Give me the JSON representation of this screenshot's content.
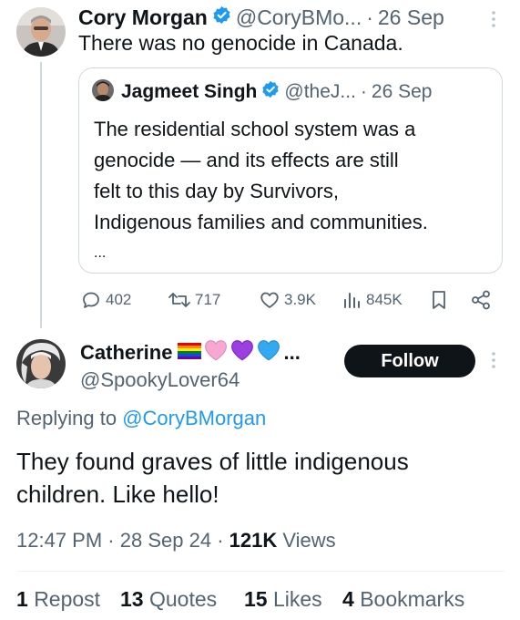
{
  "parent": {
    "name": "Cory Morgan",
    "handle": "@CoryBMo...",
    "sep": "·",
    "date": "26 Sep",
    "text": "There was no genocide in Canada."
  },
  "quote": {
    "name": "Jagmeet Singh",
    "handle": "@theJ...",
    "sep": "·",
    "date": "26 Sep",
    "lines": [
      "The residential school system was a",
      "genocide — and its effects are still",
      "felt to this day by Survivors,",
      "Indigenous families and communities.",
      "..."
    ]
  },
  "actions": {
    "replies": "402",
    "reposts": "717",
    "likes": "3.9K",
    "views": "845K"
  },
  "reply": {
    "name": "Catherine",
    "name_suffix": "...",
    "handle": "@SpookyLover64",
    "follow_label": "Follow",
    "replying_prefix": "Replying to",
    "replying_handle": "@CoryBMorgan",
    "text_lines": [
      "They found graves of little indigenous",
      "children. Like hello!"
    ],
    "time": "12:47 PM",
    "sep1": "·",
    "date": "28 Sep 24",
    "sep2": "·",
    "views_count": "121K",
    "views_label": "Views"
  },
  "stats": {
    "reposts_count": "1",
    "reposts_label": "Repost",
    "quotes_count": "13",
    "quotes_label": "Quotes",
    "likes_count": "15",
    "likes_label": "Likes",
    "bookmarks_count": "4",
    "bookmarks_label": "Bookmarks"
  },
  "colors": {
    "accent": "#1d9bf0",
    "text": "#0f1419",
    "muted": "#536471",
    "border": "#cfd9de"
  },
  "icons": [
    "verified-badge-icon",
    "more-icon",
    "reply-icon",
    "repost-icon",
    "like-icon",
    "views-icon",
    "bookmark-icon",
    "share-icon",
    "rainbow-flag-icon",
    "pink-heart-icon",
    "purple-heart-icon",
    "blue-heart-icon"
  ]
}
